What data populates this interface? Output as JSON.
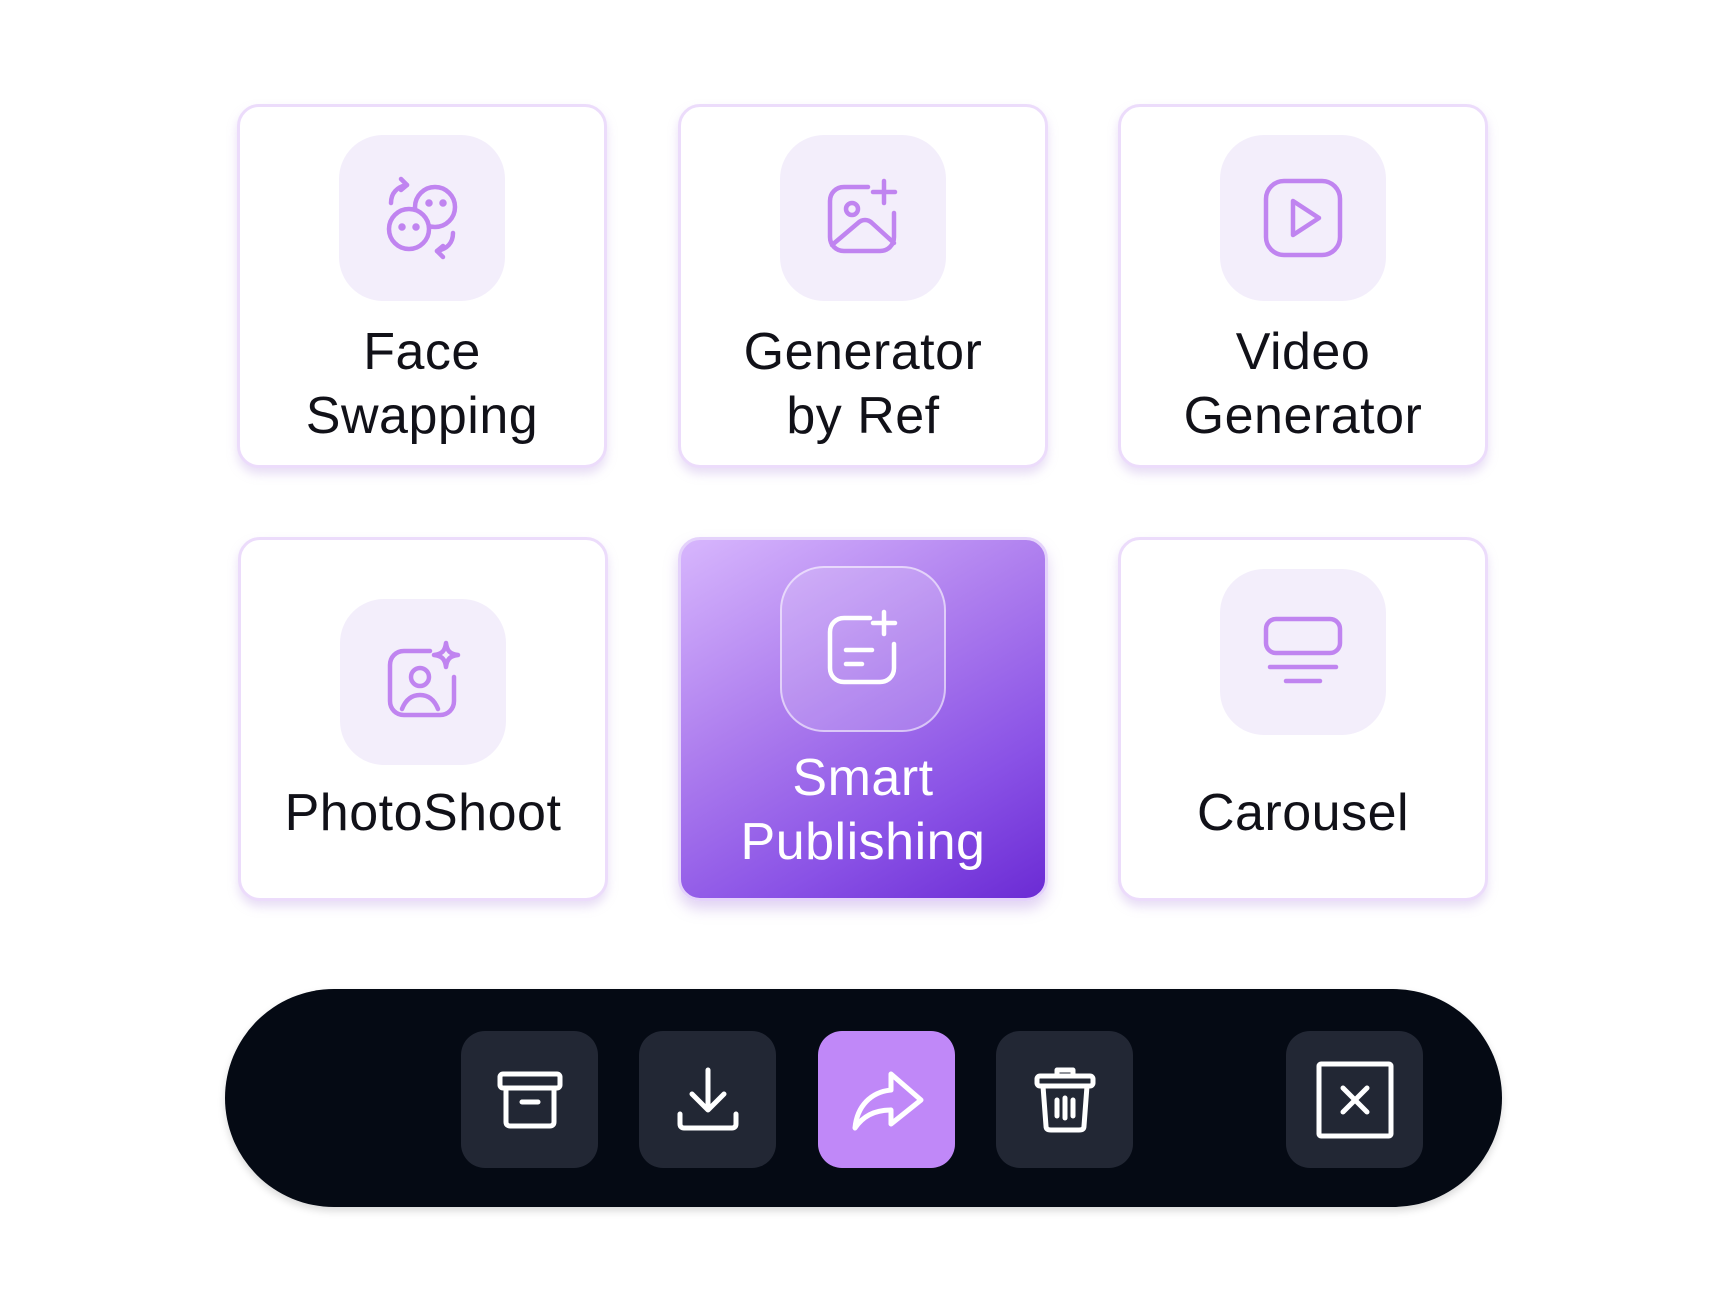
{
  "cards": [
    {
      "id": "face-swapping",
      "lines": [
        "Face",
        "Swapping"
      ],
      "icon": "face-swap-icon"
    },
    {
      "id": "generator-by-ref",
      "lines": [
        "Generator",
        "by Ref"
      ],
      "icon": "image-add-icon"
    },
    {
      "id": "video-generator",
      "lines": [
        "Video",
        "Generator"
      ],
      "icon": "video-play-icon"
    },
    {
      "id": "photoshoot",
      "lines": [
        "PhotoShoot"
      ],
      "icon": "portrait-sparkle-icon"
    },
    {
      "id": "smart-publishing",
      "lines": [
        "Smart",
        "Publishing"
      ],
      "icon": "post-add-icon",
      "active": true
    },
    {
      "id": "carousel",
      "lines": [
        "Carousel"
      ],
      "icon": "carousel-icon"
    }
  ],
  "toolbar": {
    "buttons": [
      {
        "id": "archive",
        "icon": "archive-icon"
      },
      {
        "id": "download",
        "icon": "download-icon"
      },
      {
        "id": "share",
        "icon": "share-icon",
        "active": true
      },
      {
        "id": "delete",
        "icon": "trash-icon"
      },
      {
        "id": "close",
        "icon": "close-icon"
      }
    ]
  },
  "colors": {
    "accent": "#c088f8",
    "icon_purple": "#c084f0",
    "card_border": "#ecdcfb",
    "icon_tile_bg": "#f3eefb",
    "toolbar_bg": "#050a14",
    "toolbar_button_bg": "#222734",
    "active_gradient_start": "#d7b6fd",
    "active_gradient_end": "#6b2bd4"
  }
}
